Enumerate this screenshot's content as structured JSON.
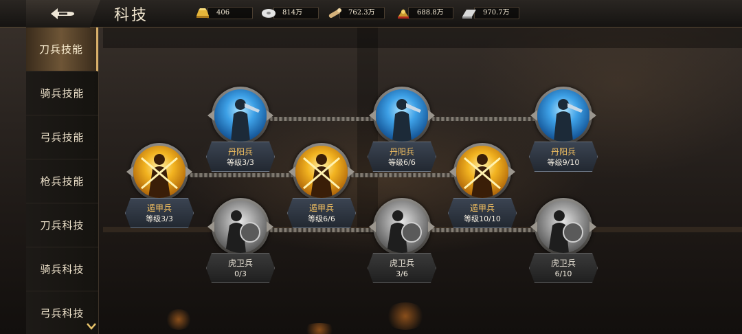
{
  "header": {
    "title": "科技",
    "resources": [
      {
        "icon": "gold-ingot-icon",
        "value": "406"
      },
      {
        "icon": "silver-coin-icon",
        "value": "814万"
      },
      {
        "icon": "scroll-icon",
        "value": "762.3万"
      },
      {
        "icon": "food-icon",
        "value": "688.8万"
      },
      {
        "icon": "iron-ingot-icon",
        "value": "970.7万"
      }
    ]
  },
  "sidebar": {
    "items": [
      {
        "label": "刀兵技能",
        "active": true
      },
      {
        "label": "骑兵技能"
      },
      {
        "label": "弓兵技能"
      },
      {
        "label": "枪兵技能"
      },
      {
        "label": "刀兵科技"
      },
      {
        "label": "骑兵科技"
      },
      {
        "label": "弓兵科技"
      }
    ]
  },
  "skills": {
    "danyang": [
      {
        "name": "丹阳兵",
        "level": "等级3/3"
      },
      {
        "name": "丹阳兵",
        "level": "等级6/6"
      },
      {
        "name": "丹阳兵",
        "level": "等级9/10"
      }
    ],
    "dunjia": [
      {
        "name": "遁甲兵",
        "level": "等级3/3"
      },
      {
        "name": "遁甲兵",
        "level": "等级6/6"
      },
      {
        "name": "遁甲兵",
        "level": "等级10/10"
      }
    ],
    "huwei": [
      {
        "name": "虎卫兵",
        "level": "0/3"
      },
      {
        "name": "虎卫兵",
        "level": "3/6"
      },
      {
        "name": "虎卫兵",
        "level": "6/10"
      }
    ]
  },
  "colors": {
    "accent_gold": "#d9b06a",
    "node_blue": "#3da0e6",
    "node_gold": "#f2b320",
    "node_gray": "#9a9a9a"
  }
}
